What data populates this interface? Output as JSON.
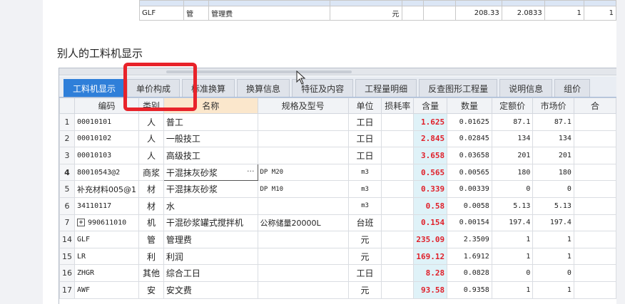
{
  "top_table": {
    "row_b": [
      "GLF",
      "管",
      "管理费",
      "元",
      "208.33",
      "2.0833",
      "1",
      "1"
    ]
  },
  "section_title": "别人的工料机显示",
  "tabs": [
    "工料机显示",
    "单价构成",
    "标准换算",
    "换算信息",
    "特征及内容",
    "工程量明细",
    "反查图形工程量",
    "说明信息",
    "组价"
  ],
  "active_tab": "工料机显示",
  "columns": [
    "编码",
    "类别",
    "名称",
    "规格及型号",
    "单位",
    "损耗率",
    "含量",
    "数量",
    "定额价",
    "市场价",
    "合"
  ],
  "rows": [
    {
      "idx": "1",
      "code": "00010101",
      "cat": "人",
      "name": "普工",
      "spec": "",
      "unit": "工日",
      "loss": "",
      "qty": "1.625",
      "amount": "0.01625",
      "price": "87.1",
      "market": "87.1"
    },
    {
      "idx": "2",
      "code": "00010102",
      "cat": "人",
      "name": "一般技工",
      "spec": "",
      "unit": "工日",
      "loss": "",
      "qty": "2.845",
      "amount": "0.02845",
      "price": "134",
      "market": "134"
    },
    {
      "idx": "3",
      "code": "00010103",
      "cat": "人",
      "name": "高级技工",
      "spec": "",
      "unit": "工日",
      "loss": "",
      "qty": "3.658",
      "amount": "0.03658",
      "price": "201",
      "market": "201"
    },
    {
      "idx": "4",
      "code": "80010543@2",
      "cat": "商浆",
      "name": "干混抹灰砂浆",
      "spec": "DP M20",
      "unit": "m3",
      "loss": "",
      "qty": "0.565",
      "amount": "0.00565",
      "price": "180",
      "market": "180"
    },
    {
      "idx": "5",
      "code": "补充材料005@1",
      "cat": "材",
      "name": "干混抹灰砂浆",
      "spec": "DP M10",
      "unit": "m3",
      "loss": "",
      "qty": "0.339",
      "amount": "0.00339",
      "price": "0",
      "market": "0"
    },
    {
      "idx": "6",
      "code": "34110117",
      "cat": "材",
      "name": "水",
      "spec": "",
      "unit": "m3",
      "loss": "",
      "qty": "0.58",
      "amount": "0.0058",
      "price": "5.13",
      "market": "5.13"
    },
    {
      "idx": "7",
      "code": "990611010",
      "cat": "机",
      "name": "干混砂浆罐式搅拌机",
      "spec": "公称储量20000L",
      "unit": "台班",
      "loss": "",
      "qty": "0.154",
      "amount": "0.00154",
      "price": "197.4",
      "market": "197.4"
    },
    {
      "idx": "14",
      "code": "GLF",
      "cat": "管",
      "name": "管理费",
      "spec": "",
      "unit": "元",
      "loss": "",
      "qty": "235.09",
      "amount": "2.3509",
      "price": "1",
      "market": "1"
    },
    {
      "idx": "15",
      "code": "LR",
      "cat": "利",
      "name": "利润",
      "spec": "",
      "unit": "元",
      "loss": "",
      "qty": "169.12",
      "amount": "1.6912",
      "price": "1",
      "market": "1"
    },
    {
      "idx": "16",
      "code": "ZHGR",
      "cat": "其他",
      "name": "综合工日",
      "spec": "",
      "unit": "工日",
      "loss": "",
      "qty": "8.28",
      "amount": "0.0828",
      "price": "0",
      "market": "0"
    },
    {
      "idx": "17",
      "code": "AWF",
      "cat": "安",
      "name": "安文费",
      "spec": "",
      "unit": "元",
      "loss": "",
      "qty": "93.58",
      "amount": "0.9358",
      "price": "1",
      "market": "1"
    }
  ],
  "name_cell_ellipsis": "···",
  "expand_symbol": "+",
  "colors": {
    "accent": "#2f7fd9",
    "highlight": "#e8232a",
    "qty_bg": "#dff2f8",
    "qty_text": "#e0202a"
  }
}
